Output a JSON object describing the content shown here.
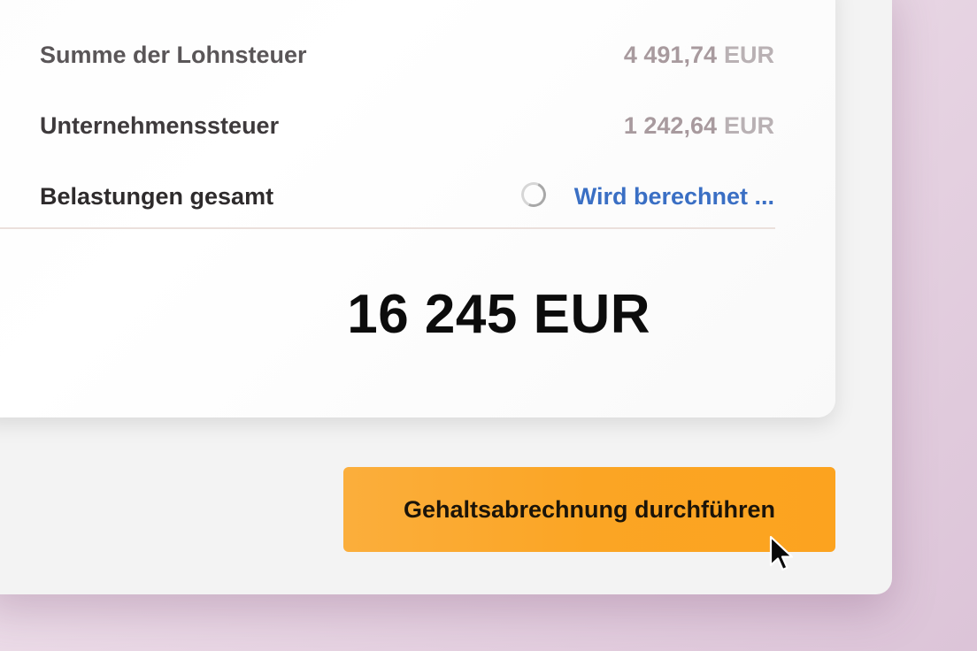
{
  "summary": {
    "rows": [
      {
        "label": "Summe der Lohnsteuer",
        "amount": "4 491,74",
        "currency": "EUR"
      },
      {
        "label": "Unternehmenssteuer",
        "amount": "1 242,64",
        "currency": "EUR"
      },
      {
        "label": "Belastungen gesamt",
        "status": "Wird berechnet ..."
      }
    ],
    "total": "16 245 EUR"
  },
  "actions": {
    "run_payroll_label": "Gehaltsabrechnung durchführen"
  },
  "icons": {
    "spinner": "loading-spinner-icon",
    "cursor": "mouse-pointer-icon"
  },
  "colors": {
    "accent_button": "#fba524",
    "status_link": "#3a6fc4",
    "muted_amount": "#a89a9e",
    "label_primary": "#2e2b2c",
    "label_secondary": "#5a5658",
    "total_text": "#0c0c0c"
  }
}
